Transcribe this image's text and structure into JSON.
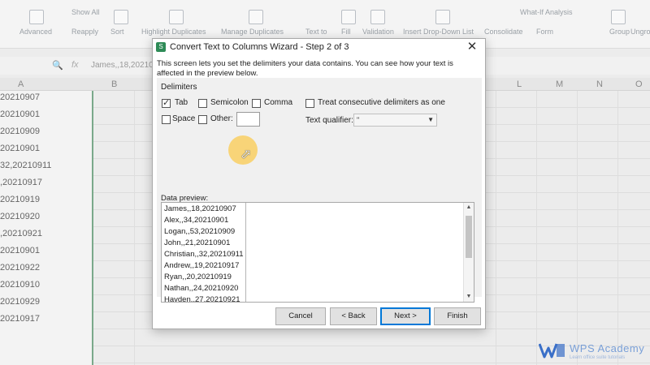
{
  "ribbon": {
    "items": [
      "Show All",
      "Reapply",
      "Advanced",
      "Sort",
      "Highlight Duplicates",
      "Manage Duplicates",
      "Text to",
      "Fill",
      "Validation",
      "Insert Drop-Down List",
      "Consolidate",
      "What-If Analysis",
      "Form",
      "Group",
      "Ungro"
    ]
  },
  "formula_bar": {
    "fx": "fx",
    "value": "James,,18,20210"
  },
  "columns": [
    "A",
    "B",
    "L",
    "M",
    "N",
    "O"
  ],
  "column_a_cells": [
    "20210907",
    "20210901",
    "20210909",
    "20210901",
    "32,20210911",
    ",20210917",
    "20210919",
    "20210920",
    ",20210921",
    "20210901",
    "20210922",
    "20210910",
    "20210929",
    "20210917"
  ],
  "dialog": {
    "title": "Convert Text to Columns Wizard - Step 2 of 3",
    "close": "✕",
    "description": "This screen lets you set the delimiters your data contains. You can see how your text is affected in the preview below.",
    "delimiters_label": "Delimiters",
    "options": {
      "tab": "Tab",
      "semicolon": "Semicolon",
      "comma": "Comma",
      "consecutive": "Treat consecutive delimiters as one",
      "space": "Space",
      "other": "Other:"
    },
    "qualifier_label": "Text qualifier:",
    "qualifier_value": "\"",
    "preview_label": "Data preview:",
    "preview_rows": [
      "James,,18,20210907",
      "Alex,,34,20210901",
      "Logan,,53,20210909",
      "John,,21,20210901",
      "Christian,,32,20210911",
      "Andrew,,19,20210917",
      "Ryan,,20,20210919",
      "Nathan,,24,20210920",
      "Hayden,,27,20210921"
    ],
    "buttons": {
      "cancel": "Cancel",
      "back": "< Back",
      "next": "Next >",
      "finish": "Finish"
    }
  },
  "watermark": {
    "title": "WPS Academy",
    "subtitle": "Learn office suite tutorials"
  }
}
